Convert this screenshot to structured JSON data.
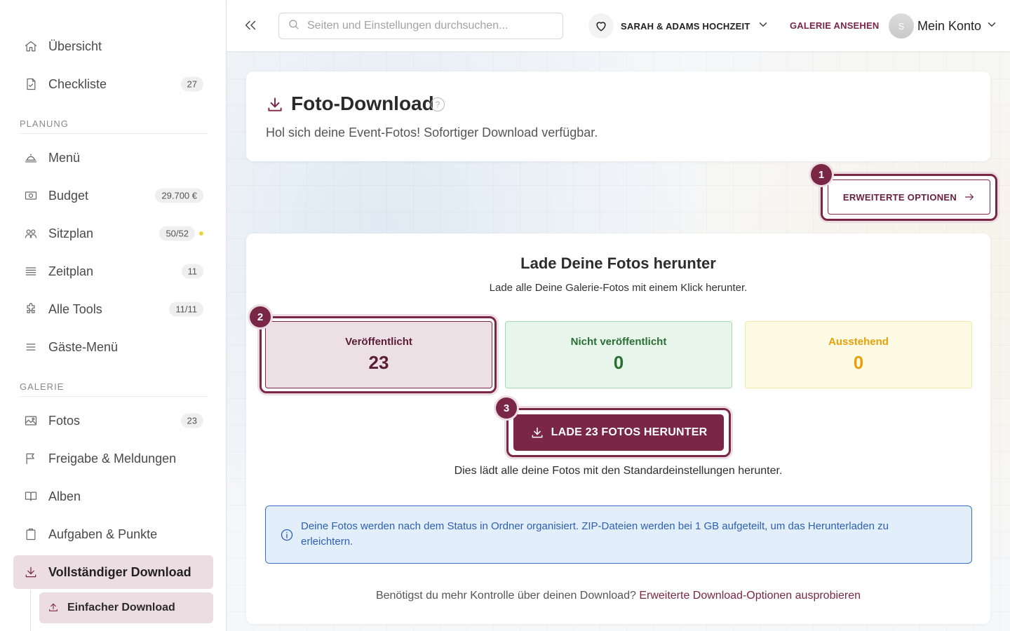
{
  "sidebar": {
    "items": [
      {
        "label": "Übersicht",
        "icon": "home-icon"
      },
      {
        "label": "Checkliste",
        "icon": "checklist-icon",
        "badge": "27"
      },
      {
        "label": "Menü",
        "icon": "cloche-icon"
      },
      {
        "label": "Budget",
        "icon": "money-icon",
        "badge": "29.700 €"
      },
      {
        "label": "Sitzplan",
        "icon": "people-icon",
        "badge": "50/52"
      },
      {
        "label": "Zeitplan",
        "icon": "list-icon",
        "badge": "11"
      },
      {
        "label": "Alle Tools",
        "icon": "puzzle-icon",
        "badge": "11/11"
      },
      {
        "label": "Gäste-Menü",
        "icon": "menu-icon"
      },
      {
        "label": "Fotos",
        "icon": "image-icon",
        "badge": "23"
      },
      {
        "label": "Freigabe & Meldungen",
        "icon": "flag-icon"
      },
      {
        "label": "Alben",
        "icon": "book-icon"
      },
      {
        "label": "Aufgaben & Punkte",
        "icon": "clipboard-icon"
      },
      {
        "label": "Vollständiger Download",
        "icon": "download-icon"
      }
    ],
    "sections": {
      "planung": "PLANUNG",
      "galerie": "GALERIE"
    },
    "sub_item": {
      "label": "Einfacher Download",
      "icon": "upload-icon"
    }
  },
  "header": {
    "search_placeholder": "Seiten und Einstellungen durchsuchen...",
    "event_name": "SARAH & ADAMS HOCHZEIT",
    "gallery_link": "GALERIE ANSEHEN",
    "avatar_initial": "S",
    "account_label": "Mein Konto"
  },
  "page": {
    "title": "Foto-Download",
    "help": "?",
    "subtitle": "Hol sich deine Event-Fotos! Sofortiger Download verfügbar.",
    "advanced_button": "ERWEITERTE OPTIONEN"
  },
  "steps": [
    "1",
    "2",
    "3"
  ],
  "download": {
    "heading": "Lade Deine Fotos herunter",
    "description": "Lade alle Deine Galerie-Fotos mit einem Klick herunter.",
    "stats": [
      {
        "label": "Veröffentlicht",
        "value": "23"
      },
      {
        "label": "Nicht veröffentlicht",
        "value": "0"
      },
      {
        "label": "Ausstehend",
        "value": "0"
      }
    ],
    "button": "LADE 23 FOTOS HERUNTER",
    "button_note": "Dies lädt alle deine Fotos mit den Standardeinstellungen herunter.",
    "info": "Deine Fotos werden nach dem Status in Ordner organisiert. ZIP-Dateien werden bei 1 GB aufgeteilt, um das Herunterladen zu erleichtern.",
    "footer_text": "Benötigst du mehr Kontrolle über deinen Download?",
    "footer_link": "Erweiterte Download-Optionen ausprobieren"
  },
  "colors": {
    "accent": "#7a2745",
    "accent_light": "#ecdde2",
    "success": "#2b6e36",
    "warning": "#e6a10a",
    "info": "#2c5fb8",
    "dot_yellow": "#f2d23a"
  }
}
